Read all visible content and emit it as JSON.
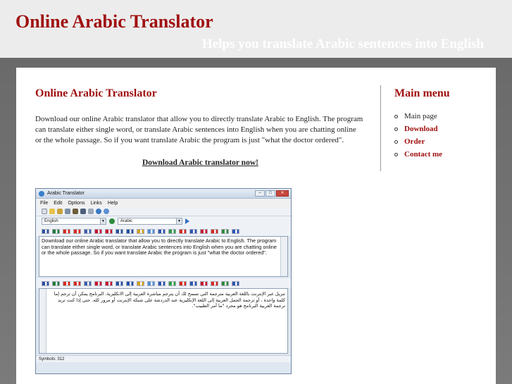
{
  "header": {
    "site_title": "Online Arabic Translator",
    "tagline": "Helps you translate Arabic sentences into English"
  },
  "main": {
    "title": "Online Arabic Translator",
    "paragraph": "Download our online Arabic translator that allow you to directly translate Arabic to English. The program can translate either single word, or translate Arabic sentences into English when you are chatting online or the whole passage. So if you want translate Arabic the program is just \"what the doctor ordered\".",
    "download_link": "Download Arabic translator now!"
  },
  "sidebar": {
    "title": "Main menu",
    "items": [
      {
        "label": "Main page"
      },
      {
        "label": "Download"
      },
      {
        "label": "Order"
      },
      {
        "label": "Contact me"
      }
    ]
  },
  "app": {
    "window_title": "Arabic Translator",
    "menu": [
      "File",
      "Edit",
      "Options",
      "Links",
      "Help"
    ],
    "source_language": "English",
    "target_language": "Arabic",
    "source_text": "Download our online Arabic translator that allow you to directly translate Arabic to English. The program can translate either single word, or translate Arabic sentences into English when you are chatting online or the whole passage. So if you want translate Arabic the program is just \"what the doctor ordered\".",
    "target_text": "تنزيل عبر الإنترنت باللغة العربية مترجمة التي تسمح لك أن يترجم مباشرة العربية إلى الانكليزية. البرنامج يمكن أن ترجم إما كلمة واحدة ، أو ترجمة الجمل العربية إلى اللغة الإنكليزية عند الدردشة على شبكة الإنترنت أو مرور كله. حتى إذا كنت تريد ترجمة العربية البرنامج هو مجرد \"ما أمر الطبيب\".",
    "status": "Symbols: 312",
    "toolbar_icons": [
      "new-icon",
      "open-icon",
      "save-icon",
      "copy-icon",
      "paste-icon",
      "print-icon",
      "settings-icon",
      "web-icon",
      "help-icon"
    ],
    "flags": [
      {
        "name": "uk-flag",
        "color": "#2b4ea0"
      },
      {
        "name": "saudi-flag",
        "color": "#1c7a3a"
      },
      {
        "name": "china-flag",
        "color": "#d62a1e"
      },
      {
        "name": "taiwan-flag",
        "color": "#d62a1e"
      },
      {
        "name": "czech-flag",
        "color": "#3a5fb0"
      },
      {
        "name": "denmark-flag",
        "color": "#c8102e"
      },
      {
        "name": "netherlands-flag",
        "color": "#c8102e"
      },
      {
        "name": "finland-flag",
        "color": "#1f4fa3"
      },
      {
        "name": "france-flag",
        "color": "#1f4fa3"
      },
      {
        "name": "germany-flag",
        "color": "#d4a017"
      },
      {
        "name": "greece-flag",
        "color": "#4b8fd6"
      },
      {
        "name": "israel-flag",
        "color": "#2a55b3"
      },
      {
        "name": "italy-flag",
        "color": "#2c9a45"
      },
      {
        "name": "japan-flag",
        "color": "#d62a1e"
      },
      {
        "name": "korea-flag",
        "color": "#2a55b3"
      },
      {
        "name": "norway-flag",
        "color": "#c8102e"
      },
      {
        "name": "poland-flag",
        "color": "#d62a1e"
      },
      {
        "name": "portugal-flag",
        "color": "#2c8a3a"
      },
      {
        "name": "russia-flag",
        "color": "#2a55b3"
      }
    ]
  }
}
